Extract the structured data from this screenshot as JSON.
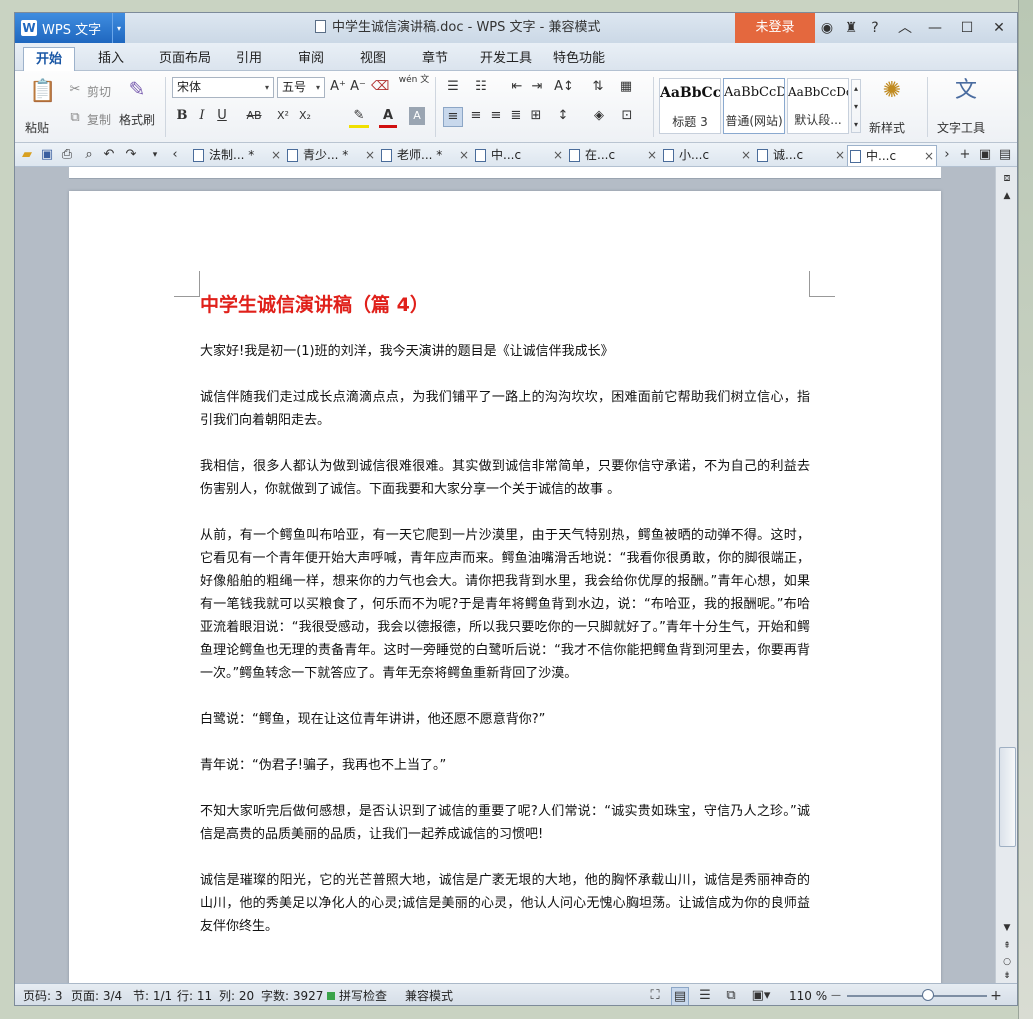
{
  "app": {
    "name": "WPS 文字",
    "logo_letter": "W",
    "dropdown_glyph": "▾"
  },
  "window": {
    "title": "中学生诚信演讲稿.doc - WPS 文字 - 兼容模式",
    "login": "未登录",
    "icons": [
      "skin-icon",
      "shirt-icon",
      "help-icon",
      "collapse-icon",
      "minimize-icon",
      "maximize-icon",
      "close-icon"
    ],
    "help": "?",
    "collapse": "︿",
    "minimize": "—",
    "maximize": "☐",
    "close": "✕"
  },
  "menu": [
    "开始",
    "插入",
    "页面布局",
    "引用",
    "审阅",
    "视图",
    "章节",
    "开发工具",
    "特色功能"
  ],
  "ribbon": {
    "paste": "粘贴",
    "cut": "剪切",
    "copy": "复制",
    "format_painter": "格式刷",
    "font": "宋体",
    "size": "五号",
    "wen_label": "wén 文",
    "bold": "B",
    "italic": "I",
    "underline": "U",
    "strike": "AB",
    "sup": "X²",
    "sub": "X₂",
    "font_color": "A",
    "styles": [
      {
        "sample": "AaBbCcI",
        "name": "标题 3"
      },
      {
        "sample": "AaBbCcD",
        "name": "普通(网站)"
      },
      {
        "sample": "AaBbCcDc",
        "name": "默认段..."
      }
    ],
    "new_style": "新样式",
    "text_tools": "文字工具"
  },
  "tabs": [
    {
      "label": "法制...",
      "mod": "*"
    },
    {
      "label": "青少...",
      "mod": "*"
    },
    {
      "label": "老师...",
      "mod": "*"
    },
    {
      "label": "中...c",
      "mod": ""
    },
    {
      "label": "在...c",
      "mod": ""
    },
    {
      "label": "小...c",
      "mod": ""
    },
    {
      "label": "诚...c",
      "mod": ""
    },
    {
      "label": "中...c",
      "mod": ""
    }
  ],
  "tab_close": "×",
  "document": {
    "heading": "中学生诚信演讲稿（篇 4）",
    "paragraphs": [
      "大家好!我是初一(1)班的刘洋，我今天演讲的题目是《让诚信伴我成长》",
      "诚信伴随我们走过成长点滴滴点点，为我们铺平了一路上的沟沟坎坎，困难面前它帮助我们树立信心，指引我们向着朝阳走去。",
      "我相信，很多人都认为做到诚信很难很难。其实做到诚信非常简单，只要你信守承诺，不为自己的利益去伤害别人，你就做到了诚信。下面我要和大家分享一个关于诚信的故事 。",
      "从前，有一个鳄鱼叫布哈亚，有一天它爬到一片沙漠里，由于天气特别热，鳄鱼被晒的动弹不得。这时，它看见有一个青年便开始大声呼喊，青年应声而来。鳄鱼油嘴滑舌地说：“我看你很勇敢，你的脚很端正，好像船舶的粗绳一样，想来你的力气也会大。请你把我背到水里，我会给你优厚的报酬。”青年心想，如果有一笔钱我就可以买粮食了，何乐而不为呢?于是青年将鳄鱼背到水边，说：“布哈亚，我的报酬呢。”布哈亚流着眼泪说：“我很受感动，我会以德报德，所以我只要吃你的一只脚就好了。”青年十分生气，开始和鳄鱼理论鳄鱼也无理的责备青年。这时一旁睡觉的白鹭听后说：“我才不信你能把鳄鱼背到河里去，你要再背一次。”鳄鱼转念一下就答应了。青年无奈将鳄鱼重新背回了沙漠。",
      "白鹭说：“鳄鱼，现在让这位青年讲讲，他还愿不愿意背你?”",
      "青年说：“伪君子!骗子，我再也不上当了。”",
      "不知大家听完后做何感想，是否认识到了诚信的重要了呢?人们常说：“诚实贵如珠宝，守信乃人之珍。”诚信是高贵的品质美丽的品质，让我们一起养成诚信的习惯吧!",
      "诚信是璀璨的阳光，它的光芒普照大地，诚信是广袤无垠的大地，他的胸怀承载山川，诚信是秀丽神奇的山川，他的秀美足以净化人的心灵;诚信是美丽的心灵，他认人问心无愧心胸坦荡。让诚信成为你的良师益友伴你终生。"
    ]
  },
  "status": {
    "page_no": "页码: 3",
    "pages": "页面: 3/4",
    "section": "节: 1/1",
    "row": "行: 11",
    "col": "列: 20",
    "words": "字数: 3927",
    "spell": "拼写检查",
    "compat": "兼容模式",
    "zoom": "110 %",
    "zoom_minus": "—",
    "zoom_plus": "+",
    "zoom_level": 0.58
  },
  "colors": {
    "accent": "#1f67bf",
    "heading": "#e0201a",
    "login": "#e4683e"
  }
}
